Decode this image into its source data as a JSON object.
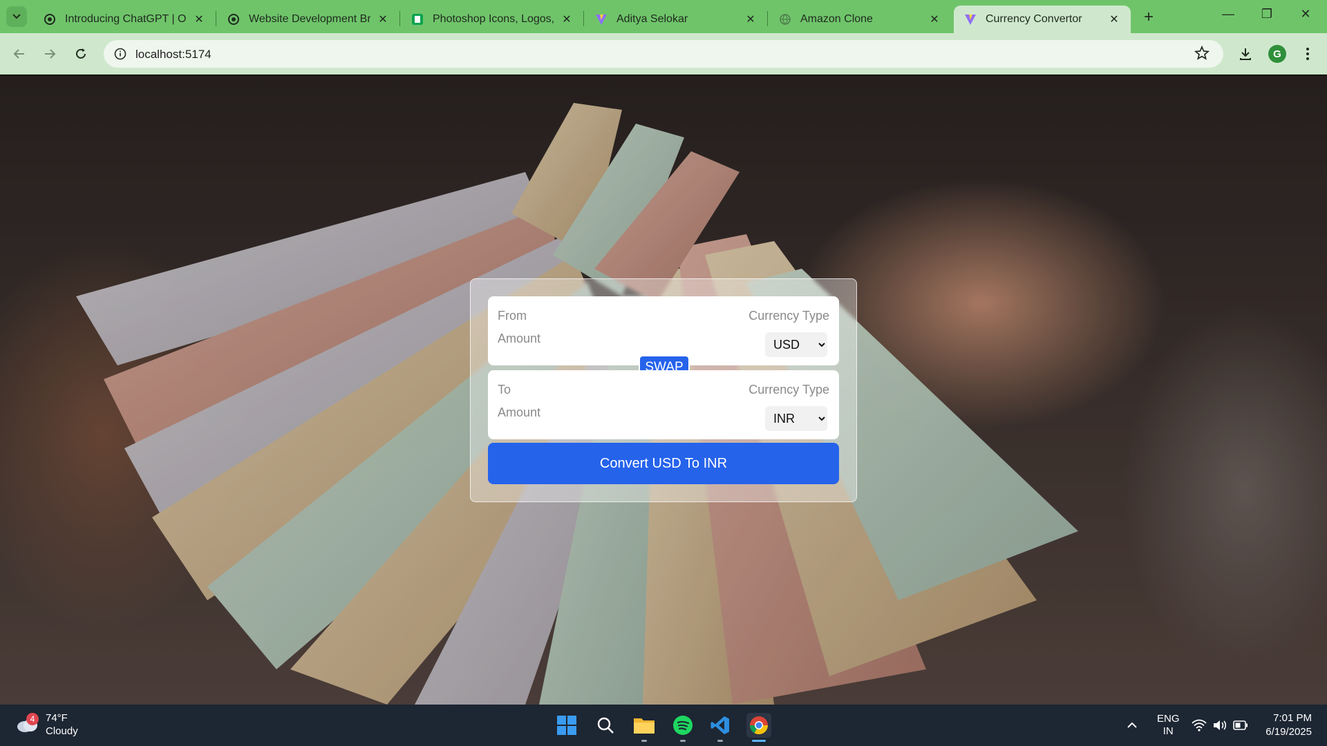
{
  "browser": {
    "tabs": [
      {
        "title": "Introducing ChatGPT | Ope",
        "icon": "openai-icon",
        "active": false
      },
      {
        "title": "Website Development Bre",
        "icon": "openai-icon",
        "active": false
      },
      {
        "title": "Photoshop Icons, Logos, S",
        "icon": "green-square-icon",
        "active": false
      },
      {
        "title": "Aditya Selokar",
        "icon": "vite-icon",
        "active": false
      },
      {
        "title": "Amazon Clone",
        "icon": "globe-icon",
        "active": false
      },
      {
        "title": "Currency Convertor",
        "icon": "vite-icon",
        "active": true
      }
    ],
    "address": "localhost:5174",
    "profile_initial": "G"
  },
  "converter": {
    "from_label": "From",
    "from_currency_label": "Currency Type",
    "from_placeholder": "Amount",
    "from_currency": "USD",
    "swap_label": "SWAP",
    "to_label": "To",
    "to_currency_label": "Currency Type",
    "to_placeholder": "Amount",
    "to_currency": "INR",
    "convert_label": "Convert USD To INR"
  },
  "taskbar": {
    "weather_temp": "74°F",
    "weather_desc": "Cloudy",
    "weather_badge": "4",
    "lang_top": "ENG",
    "lang_bottom": "IN",
    "time": "7:01 PM",
    "date": "6/19/2025"
  },
  "colors": {
    "tabbar": "#6fc46a",
    "toolbar": "#cfe8cd",
    "accent": "#2563eb",
    "taskbar": "#1d2633"
  }
}
